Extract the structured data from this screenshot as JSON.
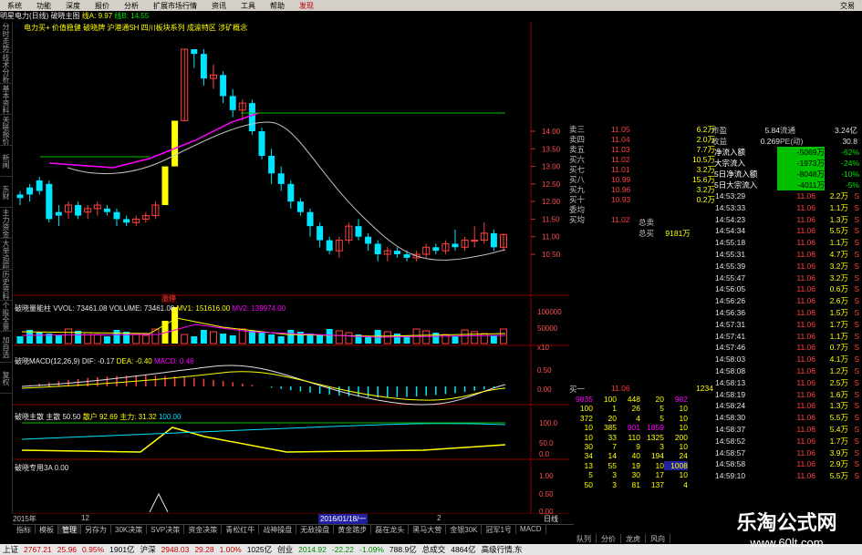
{
  "menu": [
    "系统",
    "功能",
    "深度",
    "报价",
    "分析",
    "扩展市场行情",
    "资讯",
    "工具",
    "帮助",
    "发现",
    "交易"
  ],
  "infobar": {
    "stock": "明星电力(日线)",
    "scheme": "破晓主图",
    "line_label": "线A: 9.97",
    "line_b": "线B: 14.55",
    "concepts": "电力买+ 价值稳健 破晓牌 沪港通SH 四川板块系列 成渝特区 涉矿概念"
  },
  "sidetabs": [
    "分时走势",
    "技术分析",
    "基本资料",
    "关联报价",
    "新闻",
    "东财",
    "主力资金",
    "大单追踪",
    "历史资料",
    "个股全景",
    "加自选",
    "复权"
  ],
  "price_axis": [
    "14.00",
    "13.50",
    "13.00",
    "12.50",
    "12.00",
    "11.50",
    "11.00",
    "10.50"
  ],
  "vol_axis": [
    "100000",
    "50000",
    "x10"
  ],
  "macd_axis": [
    "0.50",
    "0.00"
  ],
  "trend_axis": [
    "100.0",
    "50.0",
    "0.0"
  ],
  "last_axis": [
    "1.00",
    "0.50",
    "0.00"
  ],
  "panels": {
    "vol_title": "破晓量能柱",
    "vvol": "VVOL: 73461.08",
    "volume": "VOLUME: 73461.08",
    "mv1": "MV1: 151616.00",
    "mv2": "MV2: 139974.00",
    "macd_title": "破晓MACD(12,26,9)",
    "dif": "DIF: -0.17",
    "dea": "DEA: -0.40",
    "macd": "MACD: 0.46",
    "trend_title": "破晓主散",
    "trend_a": "主散",
    "trend_b": "50.50",
    "trend_c": "散户",
    "trend_d": "92.69",
    "trend_e": "主力: 31.32",
    "trend_f": "100.00",
    "last_title": "破晓专用3A",
    "last_val": "0.00",
    "tag": "涨停",
    "date_start": "2015年",
    "date_mark": "12",
    "date_highlight": "2016/01/18/一",
    "date_end": "2",
    "dayline": "日线"
  },
  "orderbook": [
    {
      "label": "卖三",
      "price": "11.05",
      "vol": "6.2万"
    },
    {
      "label": "卖四",
      "price": "11.04",
      "vol": "2.0万"
    },
    {
      "label": "卖五",
      "price": "11.03",
      "vol": "7.7万"
    },
    {
      "label": "买六",
      "price": "11.02",
      "vol": "10.5万"
    },
    {
      "label": "买七",
      "price": "11.01",
      "vol": "3.2万"
    },
    {
      "label": "买八",
      "price": "10.99",
      "vol": "15.6万"
    },
    {
      "label": "买九",
      "price": "10.96",
      "vol": "3.2万"
    },
    {
      "label": "买十",
      "price": "10.93",
      "vol": "0.2万"
    },
    {
      "label": "委均",
      "price": "",
      "vol": ""
    },
    {
      "label": "买均",
      "price": "11.02",
      "vol": ""
    }
  ],
  "totals": {
    "sell_label": "总卖",
    "buy_label": "总买",
    "buy_val": "9181万"
  },
  "rightinfo": [
    {
      "a": "市盈",
      "b": "5.84",
      "c": "流通",
      "d": "3.24亿"
    },
    {
      "a": "收益",
      "b": "0.269",
      "c": "PE(动)",
      "d": "30.8"
    }
  ],
  "flows": [
    {
      "label": "净流入额",
      "val": "-5069万",
      "pct": "-62%"
    },
    {
      "label": "大宗流入",
      "val": "-1973万",
      "pct": "-24%"
    },
    {
      "label": "5日净流入额",
      "val": "-8048万",
      "pct": "-10%"
    },
    {
      "label": "5日大宗流入",
      "val": "-4011万",
      "pct": "-5%"
    }
  ],
  "ticks": [
    {
      "t": "14:53:29",
      "p": "11.06",
      "v": "2.2万",
      "d": "S"
    },
    {
      "t": "14:53:33",
      "p": "11.06",
      "v": "1.1万",
      "d": "S"
    },
    {
      "t": "14:54:23",
      "p": "11.06",
      "v": "1.3万",
      "d": "S"
    },
    {
      "t": "14:54:34",
      "p": "11.06",
      "v": "5.5万",
      "d": "S"
    },
    {
      "t": "14:55:18",
      "p": "11.06",
      "v": "1.1万",
      "d": "S"
    },
    {
      "t": "14:55:31",
      "p": "11.06",
      "v": "4.7万",
      "d": "S"
    },
    {
      "t": "14:55:39",
      "p": "11.06",
      "v": "3.2万",
      "d": "S"
    },
    {
      "t": "14:55:47",
      "p": "11.06",
      "v": "3.2万",
      "d": "S"
    },
    {
      "t": "14:56:05",
      "p": "11.06",
      "v": "0.6万",
      "d": "S"
    },
    {
      "t": "14:56:26",
      "p": "11.06",
      "v": "2.6万",
      "d": "S"
    },
    {
      "t": "14:56:36",
      "p": "11.06",
      "v": "1.5万",
      "d": "S"
    },
    {
      "t": "14:57:31",
      "p": "11.06",
      "v": "1.7万",
      "d": "S"
    },
    {
      "t": "14:57:41",
      "p": "11.06",
      "v": "1.1万",
      "d": "S"
    },
    {
      "t": "14:57:46",
      "p": "11.06",
      "v": "0.7万",
      "d": "S"
    },
    {
      "t": "14:58:03",
      "p": "11.06",
      "v": "4.1万",
      "d": "S"
    },
    {
      "t": "14:58:08",
      "p": "11.06",
      "v": "1.2万",
      "d": "S"
    },
    {
      "t": "14:58:13",
      "p": "11.06",
      "v": "2.5万",
      "d": "S"
    },
    {
      "t": "14:58:19",
      "p": "11.06",
      "v": "1.6万",
      "d": "S"
    },
    {
      "t": "14:58:24",
      "p": "11.06",
      "v": "1.3万",
      "d": "S"
    },
    {
      "t": "14:58:30",
      "p": "11.06",
      "v": "5.5万",
      "d": "S"
    },
    {
      "t": "14:58:37",
      "p": "11.06",
      "v": "5.4万",
      "d": "S"
    },
    {
      "t": "14:58:52",
      "p": "11.06",
      "v": "1.7万",
      "d": "S"
    },
    {
      "t": "14:58:57",
      "p": "11.06",
      "v": "3.9万",
      "d": "S"
    },
    {
      "t": "14:58:58",
      "p": "11.06",
      "v": "2.9万",
      "d": "S"
    },
    {
      "t": "14:59:10",
      "p": "11.06",
      "v": "5.5万",
      "d": "S"
    }
  ],
  "buy_one": {
    "label": "买一",
    "price": "11.06",
    "vol": "1234"
  },
  "depth_rows": [
    [
      "9835",
      "100",
      "448",
      "20",
      "982"
    ],
    [
      "100",
      "1",
      "26",
      "5",
      "10"
    ],
    [
      "372",
      "20",
      "4",
      "5",
      "10"
    ],
    [
      "10",
      "385",
      "901",
      "1859",
      "10"
    ],
    [
      "10",
      "33",
      "110",
      "1325",
      "200"
    ],
    [
      "30",
      "7",
      "9",
      "3",
      "10"
    ],
    [
      "34",
      "14",
      "40",
      "194",
      "24"
    ],
    [
      "13",
      "55",
      "19",
      "10",
      "1008"
    ],
    [
      "5",
      "3",
      "30",
      "17",
      "10"
    ],
    [
      "50",
      "3",
      "81",
      "137",
      "4"
    ]
  ],
  "bottom_tabs": [
    "指标",
    "模板",
    "管理",
    "另存为",
    "30K决策",
    "SVP决策",
    "资金决策",
    "青松红牛",
    "战神操盘",
    "无敌操盘",
    "黄金踏步",
    "磊在龙头",
    "黑马大营",
    "金银30K",
    "冠军1号",
    "MACD"
  ],
  "right_tabs": [
    "队列",
    "分价",
    "龙虎",
    "风向"
  ],
  "statusbar": [
    {
      "text": "上证",
      "c": "#000"
    },
    {
      "text": "2767.21",
      "c": "#c00"
    },
    {
      "text": "25.96",
      "c": "#c00"
    },
    {
      "text": "0.95%",
      "c": "#c00"
    },
    {
      "text": "1901亿",
      "c": "#000"
    },
    {
      "text": "沪深",
      "c": "#000"
    },
    {
      "text": "2948.03",
      "c": "#c00"
    },
    {
      "text": "29.28",
      "c": "#c00"
    },
    {
      "text": "1.00%",
      "c": "#c00"
    },
    {
      "text": "1025亿",
      "c": "#000"
    },
    {
      "text": "创业",
      "c": "#000"
    },
    {
      "text": "2014.92",
      "c": "#080"
    },
    {
      "text": "-22.22",
      "c": "#080"
    },
    {
      "text": "-1.09%",
      "c": "#080"
    },
    {
      "text": "788.9亿",
      "c": "#000"
    },
    {
      "text": "总成交",
      "c": "#000"
    },
    {
      "text": "4864亿",
      "c": "#000"
    },
    {
      "text": "高级行情,东",
      "c": "#000"
    }
  ],
  "watermark": {
    "title": "乐淘公式网",
    "url": "www.60lt.com"
  }
}
